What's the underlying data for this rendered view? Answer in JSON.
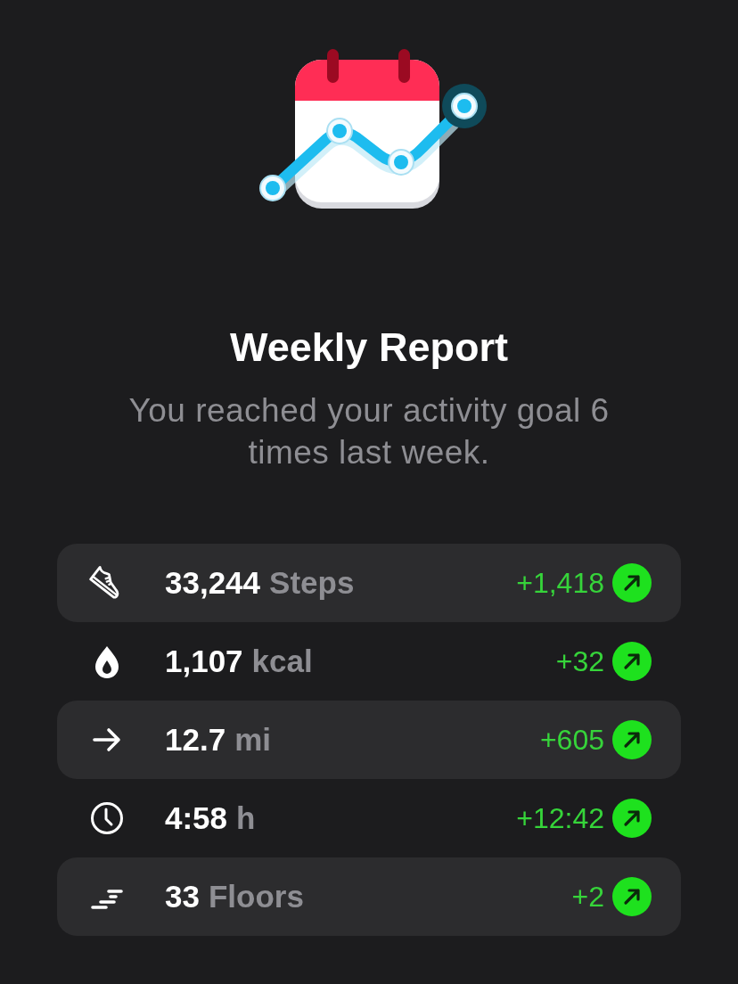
{
  "header": {
    "title": "Weekly Report",
    "subtitle": "You reached your activity goal 6 times last week."
  },
  "rows": [
    {
      "kind": "steps",
      "value": "33,244",
      "unit": "Steps",
      "change": "+1,418",
      "increased": true
    },
    {
      "kind": "calories",
      "value": "1,107",
      "unit": "kcal",
      "change": "+32",
      "increased": true
    },
    {
      "kind": "distance",
      "value": "12.7",
      "unit": "mi",
      "change": "+605",
      "increased": true
    },
    {
      "kind": "time",
      "value": "4:58",
      "unit": "h",
      "change": "+12:42",
      "increased": true
    },
    {
      "kind": "floors",
      "value": "33",
      "unit": "Floors",
      "change": "+2",
      "increased": true
    }
  ]
}
